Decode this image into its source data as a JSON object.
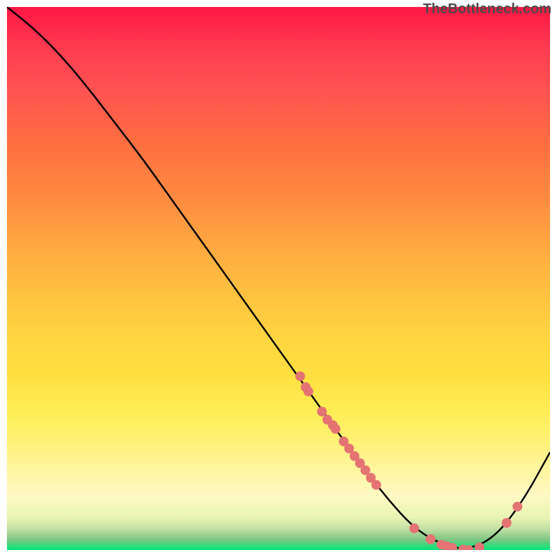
{
  "watermark_text": "TheBottleneck.com",
  "chart_data": {
    "type": "line",
    "title": "",
    "xlabel": "",
    "ylabel": "",
    "xlim": [
      0,
      100
    ],
    "ylim": [
      0,
      100
    ],
    "grid": false,
    "legend": false,
    "series": [
      {
        "name": "curve",
        "kind": "line",
        "x": [
          0,
          5,
          10,
          15,
          20,
          25,
          30,
          35,
          40,
          45,
          50,
          55,
          60,
          65,
          70,
          75,
          80,
          85,
          90,
          95,
          100
        ],
        "y": [
          100,
          96,
          91,
          85,
          78.5,
          72,
          65,
          58,
          51,
          44,
          37,
          30,
          23,
          16,
          9.5,
          4,
          1,
          0,
          2.5,
          9,
          18
        ]
      },
      {
        "name": "data-points",
        "kind": "scatter",
        "points": [
          {
            "x": 54,
            "y": 32
          },
          {
            "x": 55,
            "y": 30
          },
          {
            "x": 55.5,
            "y": 29.2
          },
          {
            "x": 58,
            "y": 25.5
          },
          {
            "x": 59,
            "y": 24
          },
          {
            "x": 60,
            "y": 23
          },
          {
            "x": 60.5,
            "y": 22.3
          },
          {
            "x": 62,
            "y": 20
          },
          {
            "x": 63,
            "y": 18.7
          },
          {
            "x": 64,
            "y": 17.3
          },
          {
            "x": 65,
            "y": 16
          },
          {
            "x": 66,
            "y": 14.7
          },
          {
            "x": 67,
            "y": 13.3
          },
          {
            "x": 68,
            "y": 12
          },
          {
            "x": 75,
            "y": 4
          },
          {
            "x": 78,
            "y": 2
          },
          {
            "x": 80,
            "y": 1
          },
          {
            "x": 81,
            "y": 0.7
          },
          {
            "x": 82,
            "y": 0.4
          },
          {
            "x": 84,
            "y": 0.1
          },
          {
            "x": 85,
            "y": 0
          },
          {
            "x": 87,
            "y": 0.5
          },
          {
            "x": 92,
            "y": 5
          },
          {
            "x": 94,
            "y": 8
          }
        ]
      }
    ],
    "background_gradient": {
      "top": "#ff1744",
      "middle": "#ffd740",
      "bottom": "#00e676"
    }
  }
}
